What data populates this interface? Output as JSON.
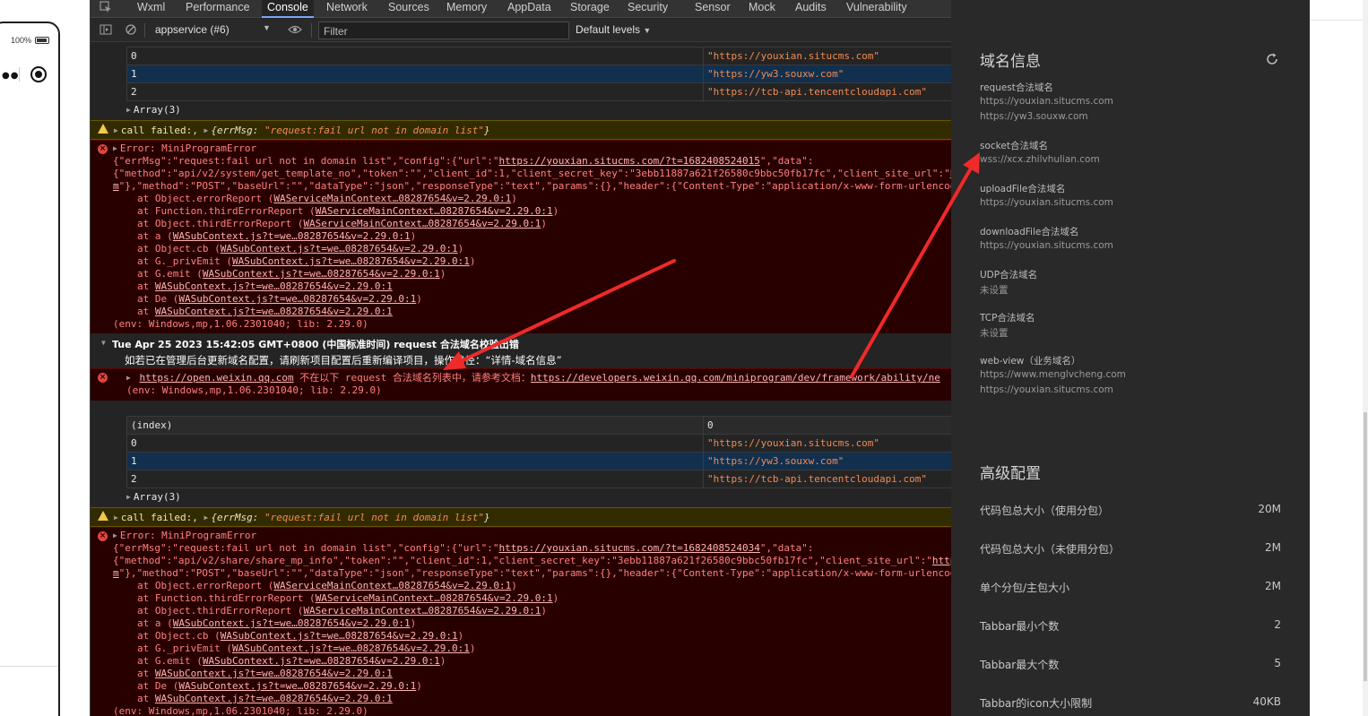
{
  "simulator": {
    "zoom": "100%"
  },
  "devtools": {
    "tabs": [
      "Wxml",
      "Performance",
      "Console",
      "Network",
      "Sources",
      "Memory",
      "AppData",
      "Storage",
      "Security",
      "Sensor",
      "Mock",
      "Audits",
      "Vulnerability"
    ],
    "active_tab": "Console",
    "context": "appservice (#6)",
    "filter_placeholder": "Filter",
    "levels": "Default levels"
  },
  "console": {
    "table1": {
      "rows": [
        {
          "index": "0",
          "value": "\"https://youxian.situcms.com\""
        },
        {
          "index": "1",
          "value": "\"https://yw3.souxw.com\""
        },
        {
          "index": "2",
          "value": "\"https://tcb-api.tencentcloudapi.com\""
        }
      ],
      "array_label": "Array(3)"
    },
    "warn1": {
      "prefix": "call failed:,",
      "obj_key": "{errMsg: ",
      "obj_val": "\"request:fail url not in domain list\"",
      "obj_end": "}"
    },
    "error1": {
      "title": "Error: MiniProgramError",
      "l1_a": "{\"errMsg\":\"request:fail url not in domain list\",\"config\":{\"url\":\"",
      "l1_link": "https://youxian.situcms.com/?t=1682408524015",
      "l1_b": "\",\"data\":",
      "l2": "{\"method\":\"api/v2/system/get_template_no\",\"token\":\"\",\"client_id\":1,\"client_secret_key\":\"3ebb11887a621f26580c9bbc50fb17fc\",\"client_site_url\":\"",
      "l2_link": "h",
      "l3_link": "m",
      "l3": "\"},\"method\":\"POST\",\"baseUrl\":\"\",\"dataType\":\"json\",\"responseType\":\"text\",\"params\":{},\"header\":{\"Content-Type\":\"application/x-www-form-urlencod",
      "stack": [
        {
          "fn": "at Object.errorReport (",
          "src": "WAServiceMainContext…08287654&v=2.29.0:1",
          "end": ")"
        },
        {
          "fn": "at Function.thirdErrorReport (",
          "src": "WAServiceMainContext…08287654&v=2.29.0:1",
          "end": ")"
        },
        {
          "fn": "at Object.thirdErrorReport (",
          "src": "WAServiceMainContext…08287654&v=2.29.0:1",
          "end": ")"
        },
        {
          "fn": "at a (",
          "src": "WASubContext.js?t=we…08287654&v=2.29.0:1",
          "end": ")"
        },
        {
          "fn": "at Object.cb (",
          "src": "WASubContext.js?t=we…08287654&v=2.29.0:1",
          "end": ")"
        },
        {
          "fn": "at G._privEmit (",
          "src": "WASubContext.js?t=we…08287654&v=2.29.0:1",
          "end": ")"
        },
        {
          "fn": "at G.emit (",
          "src": "WASubContext.js?t=we…08287654&v=2.29.0:1",
          "end": ")"
        },
        {
          "fn": "at ",
          "src": "WASubContext.js?t=we…08287654&v=2.29.0:1",
          "end": ""
        },
        {
          "fn": "at De (",
          "src": "WASubContext.js?t=we…08287654&v=2.29.0:1",
          "end": ")"
        },
        {
          "fn": "at ",
          "src": "WASubContext.js?t=we…08287654&v=2.29.0:1",
          "end": ""
        }
      ],
      "env": "(env: Windows,mp,1.06.2301040; lib: 2.29.0)"
    },
    "group": {
      "title": "Tue Apr 25 2023 15:42:05 GMT+0800 (中国标准时间) request 合法域名校验出错",
      "hint": "如若已在管理后台更新域名配置，请刷新项目配置后重新编译项目，操作路径：“详情-域名信息”",
      "err_link1": "https://open.weixin.qq.com",
      "err_mid": " 不在以下 request 合法域名列表中，请参考文档：",
      "err_link2": "https://developers.weixin.qq.com/miniprogram/dev/framework/ability/ne",
      "env": "(env: Windows,mp,1.06.2301040; lib: 2.29.0)"
    },
    "table2": {
      "header_index": "(index)",
      "header_value": "0",
      "rows": [
        {
          "index": "0",
          "value": "\"https://youxian.situcms.com\""
        },
        {
          "index": "1",
          "value": "\"https://yw3.souxw.com\""
        },
        {
          "index": "2",
          "value": "\"https://tcb-api.tencentcloudapi.com\""
        }
      ],
      "array_label": "Array(3)"
    },
    "warn2": {
      "prefix": "call failed:,",
      "obj_key": "{errMsg: ",
      "obj_val": "\"request:fail url not in domain list\"",
      "obj_end": "}"
    },
    "error2": {
      "title": "Error: MiniProgramError",
      "l1_a": "{\"errMsg\":\"request:fail url not in domain list\",\"config\":{\"url\":\"",
      "l1_link": "https://youxian.situcms.com/?t=1682408524034",
      "l1_b": "\",\"data\":",
      "l2": "{\"method\":\"api/v2/share/share_mp_info\",\"token\":\"\",\"client_id\":1,\"client_secret_key\":\"3ebb11887a621f26580c9bbc50fb17fc\",\"client_site_url\":\"",
      "l2_link": "http",
      "l3_link": "m",
      "l3": "\"},\"method\":\"POST\",\"baseUrl\":\"\",\"dataType\":\"json\",\"responseType\":\"text\",\"params\":{},\"header\":{\"Content-Type\":\"application/x-www-form-urlencod",
      "env": "(env: Windows,mp,1.06.2301040; lib: 2.29.0)"
    }
  },
  "panel": {
    "domain_title": "域名信息",
    "domains": [
      {
        "label": "request合法域名",
        "values": [
          "https://youxian.situcms.com",
          "https://yw3.souxw.com"
        ]
      },
      {
        "label": "socket合法域名",
        "values": [
          "wss://xcx.zhilvhulian.com"
        ]
      },
      {
        "label": "uploadFile合法域名",
        "values": [
          "https://youxian.situcms.com"
        ]
      },
      {
        "label": "downloadFile合法域名",
        "values": [
          "https://youxian.situcms.com"
        ]
      },
      {
        "label": "UDP合法域名",
        "values": [
          "未设置"
        ]
      },
      {
        "label": "TCP合法域名",
        "values": [
          "未设置"
        ]
      },
      {
        "label": "web-view（业务域名）",
        "values": [
          "https://www.menglvcheng.com",
          "https://youxian.situcms.com"
        ]
      }
    ],
    "advanced_title": "高级配置",
    "advanced": [
      {
        "label": "代码包总大小（使用分包）",
        "value": "20M"
      },
      {
        "label": "代码包总大小（未使用分包）",
        "value": "2M"
      },
      {
        "label": "单个分包/主包大小",
        "value": "2M"
      },
      {
        "label": "Tabbar最小个数",
        "value": "2"
      },
      {
        "label": "Tabbar最大个数",
        "value": "5"
      },
      {
        "label": "Tabbar的icon大小限制",
        "value": "40KB"
      }
    ]
  },
  "colors": {
    "error_bg": "#290000",
    "warn_bg": "#332b00",
    "arrow": "#ee2a2a",
    "selected_row": "#12304d"
  }
}
